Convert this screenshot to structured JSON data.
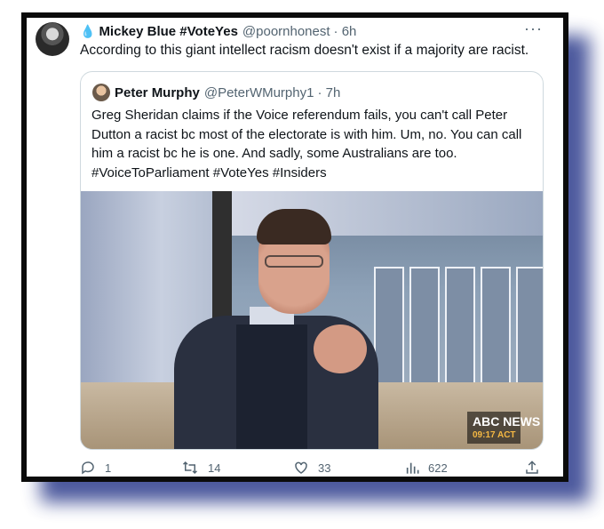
{
  "tweet": {
    "author_name": "Mickey Blue #VoteYes",
    "author_handle": "@poornhonest",
    "time": "· 6h",
    "more": "···",
    "text": "According to this giant intellect racism doesn't exist if a majority are racist."
  },
  "quote": {
    "author_name": "Peter Murphy",
    "author_handle": "@PeterWMurphy1",
    "time": "· 7h",
    "text": "Greg Sheridan claims if the Voice referendum fails, you can't call Peter Dutton a racist bc most of the electorate is with him. Um, no. You can call him a racist bc he is one. And sadly, some Australians are too. #VoiceToParliament #VoteYes #Insiders",
    "media": {
      "logo": "ABC NEWS",
      "time": "09:17 ACT"
    }
  },
  "actions": {
    "replies": "1",
    "retweets": "14",
    "likes": "33",
    "views": "622"
  },
  "icons": {
    "drop": "water-drop-icon",
    "reply": "reply-icon",
    "retweet": "retweet-icon",
    "like": "heart-icon",
    "views": "views-icon",
    "share": "share-icon"
  },
  "colors": {
    "accent": "#1d9bf0",
    "muted": "#536471",
    "frame": "#0b0b0b",
    "shadow": "#2d3c8c"
  }
}
